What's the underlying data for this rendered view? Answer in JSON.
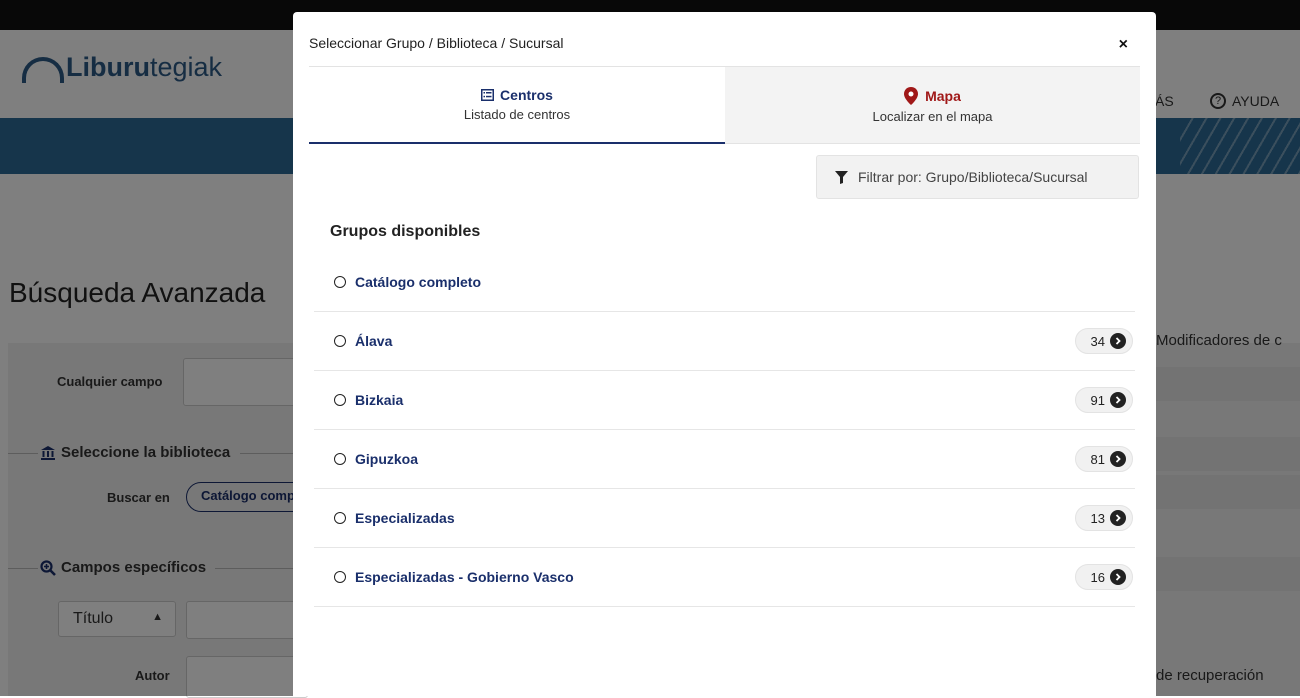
{
  "app": {
    "logo": {
      "bold": "Liburu",
      "rest": "tegiak"
    },
    "nav": {
      "mas": "ÁS",
      "ayuda": "AYUDA"
    },
    "page_title": "Búsqueda Avanzada",
    "form": {
      "cualquier_campo": "Cualquier campo",
      "seleccione": "Seleccione la biblioteca",
      "buscar_en": "Buscar en",
      "catalogo_btn": "Catálogo compl",
      "campos_especificos": "Campos específicos",
      "titulo_select": "Título",
      "autor": "Autor"
    },
    "right": {
      "modificadores": "Modificadores de c",
      "recuperacion": "de recuperación"
    }
  },
  "modal": {
    "title": "Seleccionar Grupo / Biblioteca / Sucursal",
    "close": "×",
    "tabs": [
      {
        "label": "Centros",
        "sub": "Listado de centros",
        "icon": "list-icon",
        "active": true
      },
      {
        "label": "Mapa",
        "sub": "Localizar en el mapa",
        "icon": "map-marker-icon",
        "active": false
      }
    ],
    "filter_placeholder": "Filtrar por: Grupo/Biblioteca/Sucursal",
    "grupos_title": "Grupos disponibles",
    "groups": [
      {
        "label": "Catálogo completo",
        "count": null
      },
      {
        "label": "Álava",
        "count": "34"
      },
      {
        "label": "Bizkaia",
        "count": "91"
      },
      {
        "label": "Gipuzkoa",
        "count": "81"
      },
      {
        "label": "Especializadas",
        "count": "13"
      },
      {
        "label": "Especializadas - Gobierno Vasco",
        "count": "16"
      }
    ]
  },
  "colors": {
    "navy": "#1a2f6b",
    "mapa_red": "#a01818",
    "banner": "#2c6b97"
  }
}
